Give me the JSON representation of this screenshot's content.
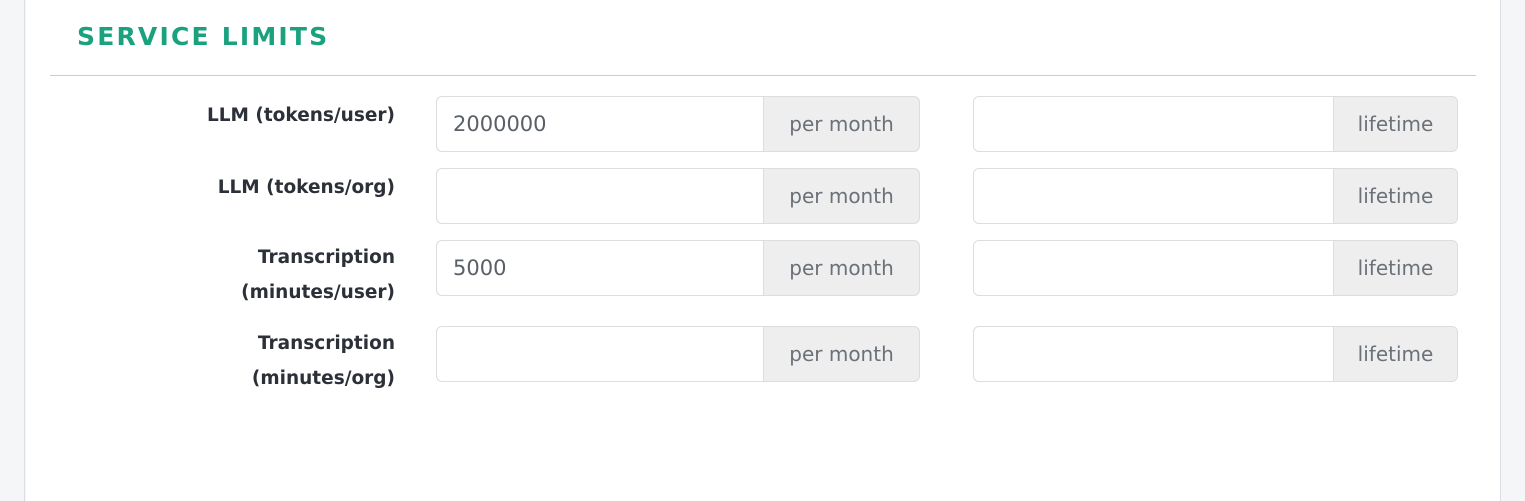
{
  "theme": {
    "heading_color": "#1aa17e",
    "label_color": "#2c3038",
    "input_border": "#dddddd",
    "addon_bg": "#eeeeee",
    "addon_text": "#6b7178",
    "rule_color": "#c6ced3",
    "gutter_bg": "#f5f6f7",
    "panel_bg": "#ffffff"
  },
  "section": {
    "title": "SERVICE LIMITS"
  },
  "form": {
    "rows": [
      {
        "label_lines": [
          "LLM (tokens/user)"
        ],
        "primary": {
          "value": "2000000",
          "placeholder": "",
          "addon": "per month"
        },
        "secondary": {
          "value": "",
          "placeholder": "",
          "addon": "lifetime"
        }
      },
      {
        "label_lines": [
          "LLM (tokens/org)"
        ],
        "primary": {
          "value": "",
          "placeholder": "",
          "addon": "per month"
        },
        "secondary": {
          "value": "",
          "placeholder": "",
          "addon": "lifetime"
        }
      },
      {
        "label_lines": [
          "Transcription",
          "(minutes/user)"
        ],
        "primary": {
          "value": "5000",
          "placeholder": "",
          "addon": "per month"
        },
        "secondary": {
          "value": "",
          "placeholder": "",
          "addon": "lifetime"
        }
      },
      {
        "label_lines": [
          "Transcription",
          "(minutes/org)"
        ],
        "primary": {
          "value": "",
          "placeholder": "",
          "addon": "per month"
        },
        "secondary": {
          "value": "",
          "placeholder": "",
          "addon": "lifetime"
        }
      }
    ]
  }
}
